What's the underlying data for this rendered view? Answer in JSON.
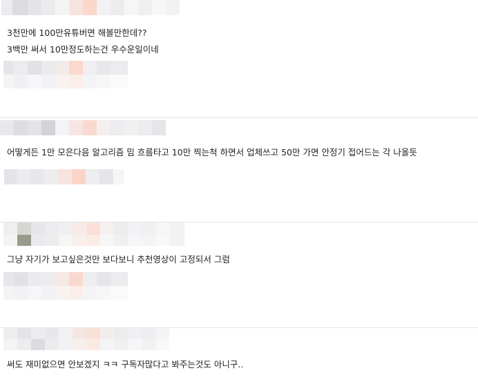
{
  "comments": [
    {
      "lines": [
        "3천만에 100만유튜버면 해볼만한데??",
        "3백만 써서 10만정도하는건 우수운일이네"
      ]
    },
    {
      "lines": [
        "어떻게든 1만 모은다음 알고리즘 밈 흐름타고 10만 찍는척 하면서 업체쓰고 50만 가면 안정기 접어드는 각 나올듯"
      ]
    },
    {
      "lines": [
        "그냥 자기가 보고싶은것만 보다보니 추천영상이 고정되서 그럼"
      ]
    },
    {
      "lines": [
        "써도 재미없으면 안보겠지 ㅋㅋ 구독자많다고 봐주는것도 아니구.."
      ]
    }
  ],
  "colors": {
    "background": "#ffffff",
    "divider": "#e6e6e6",
    "text": "#222222"
  }
}
